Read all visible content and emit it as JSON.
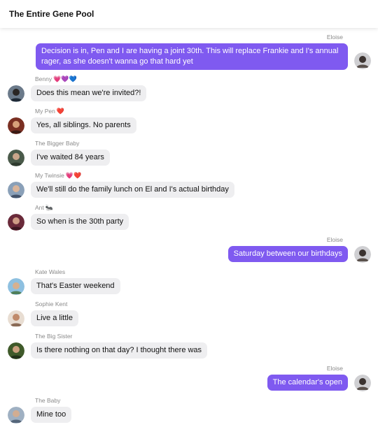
{
  "header": {
    "title": "The Entire Gene Pool"
  },
  "colors": {
    "outgoing_bubble": "#7f5af0",
    "incoming_bubble": "#eeeef0",
    "sender_name": "#8a8a8a"
  },
  "messages": [
    {
      "sender": "Eloise",
      "emoji": "",
      "text": "Decision is in, Pen and I are having a joint 30th. This will replace Frankie and I's annual rager, as she doesn't wanna go that hard yet",
      "direction": "outgoing"
    },
    {
      "sender": "Benny",
      "emoji": "💗💜💙",
      "text": "Does this mean we're invited?!",
      "direction": "incoming"
    },
    {
      "sender": "My Pen",
      "emoji": "❤️",
      "text": "Yes, all siblings. No parents",
      "direction": "incoming"
    },
    {
      "sender": "The Bigger Baby",
      "emoji": "",
      "text": "I've waited 84 years",
      "direction": "incoming"
    },
    {
      "sender": "My Twinsie",
      "emoji": "💗❤️",
      "text": "We'll still do the family lunch on El and I's actual birthday",
      "direction": "incoming"
    },
    {
      "sender": "Ant",
      "emoji": "🐜",
      "text": "So when is the 30th party",
      "direction": "incoming"
    },
    {
      "sender": "Eloise",
      "emoji": "",
      "text": "Saturday between our birthdays",
      "direction": "outgoing"
    },
    {
      "sender": "Kate Wales",
      "emoji": "",
      "text": "That's Easter weekend",
      "direction": "incoming"
    },
    {
      "sender": "Sophie Kent",
      "emoji": "",
      "text": "Live a little",
      "direction": "incoming"
    },
    {
      "sender": "The Big Sister",
      "emoji": "",
      "text": "Is there nothing on that day? I thought there was",
      "direction": "incoming"
    },
    {
      "sender": "Eloise",
      "emoji": "",
      "text": "The calendar's open",
      "direction": "outgoing"
    },
    {
      "sender": "The Baby",
      "emoji": "",
      "text": "Mine too",
      "direction": "incoming"
    }
  ]
}
